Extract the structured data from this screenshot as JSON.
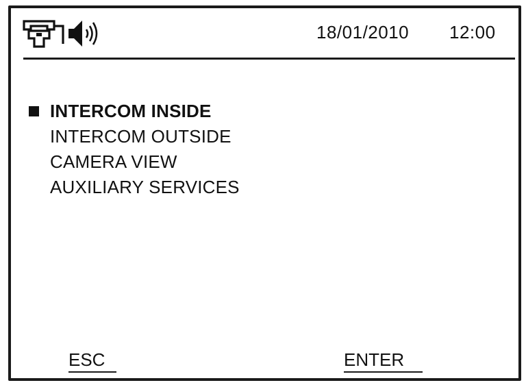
{
  "status_bar": {
    "icons": [
      "phone-handset-icon",
      "speaker-volume-icon"
    ],
    "date": "18/01/2010",
    "time": "12:00"
  },
  "menu": {
    "selected_index": 0,
    "items": [
      {
        "label": "INTERCOM INSIDE",
        "selected": true
      },
      {
        "label": "INTERCOM OUTSIDE",
        "selected": false
      },
      {
        "label": "CAMERA VIEW",
        "selected": false
      },
      {
        "label": "AUXILIARY SERVICES",
        "selected": false
      }
    ]
  },
  "softkeys": {
    "left_label": "ESC",
    "right_label": "ENTER"
  },
  "colors": {
    "foreground": "#111111",
    "background": "#ffffff"
  }
}
